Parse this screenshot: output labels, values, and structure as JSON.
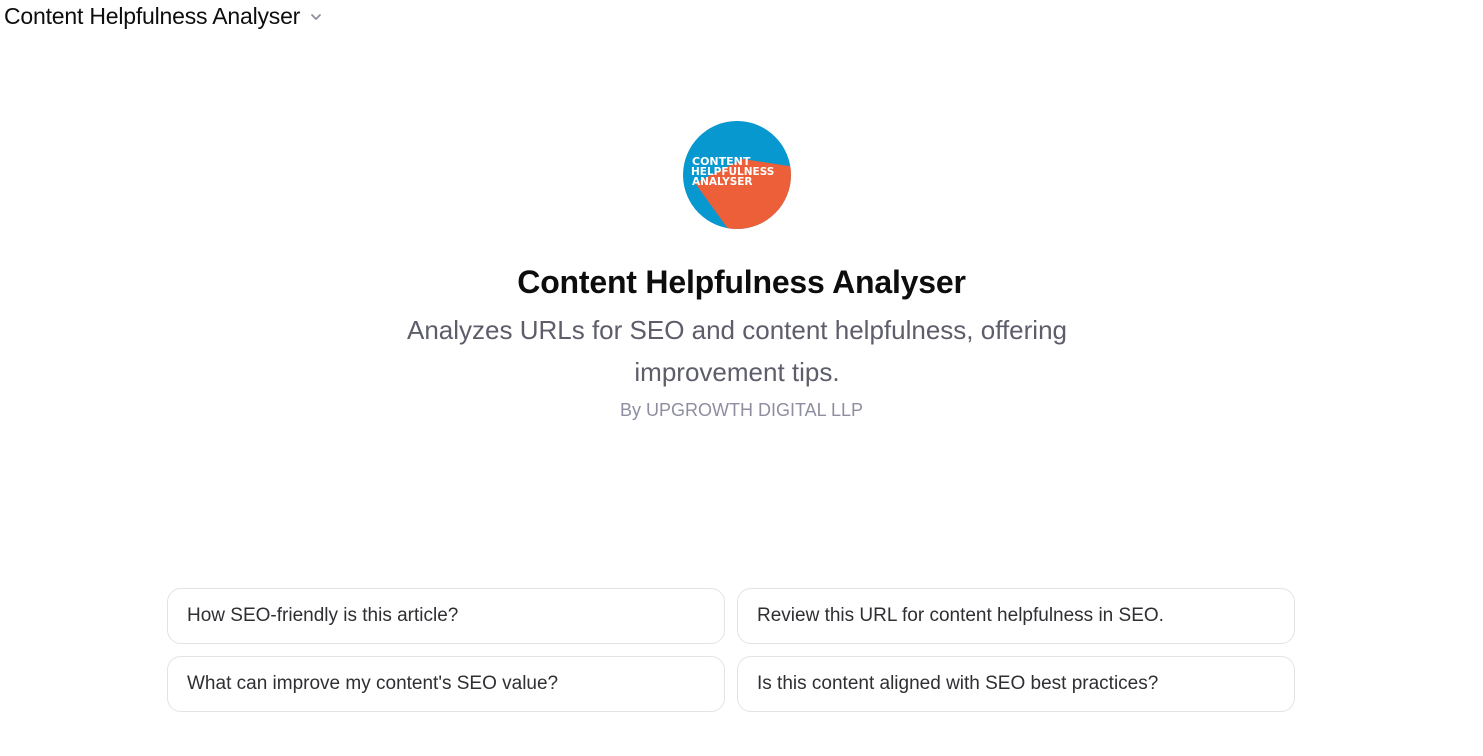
{
  "header": {
    "title": "Content Helpfulness Analyser",
    "chevron_icon": "chevron-down-icon"
  },
  "logo": {
    "line1": "CONTENT",
    "line2": "HELPFULNESS",
    "line3": "ANALYSER",
    "colors": {
      "blue": "#0798d0",
      "orange": "#ec5f38",
      "text": "#ffffff"
    }
  },
  "main": {
    "title": "Content Helpfulness Analyser",
    "description": "Analyzes URLs for SEO and content helpfulness, offering improvement tips.",
    "author": "By UPGROWTH DIGITAL LLP"
  },
  "prompts": [
    {
      "label": "How SEO-friendly is this article?"
    },
    {
      "label": "Review this URL for content helpfulness in SEO."
    },
    {
      "label": "What can improve my content's SEO value?"
    },
    {
      "label": "Is this content aligned with SEO best practices?"
    }
  ]
}
